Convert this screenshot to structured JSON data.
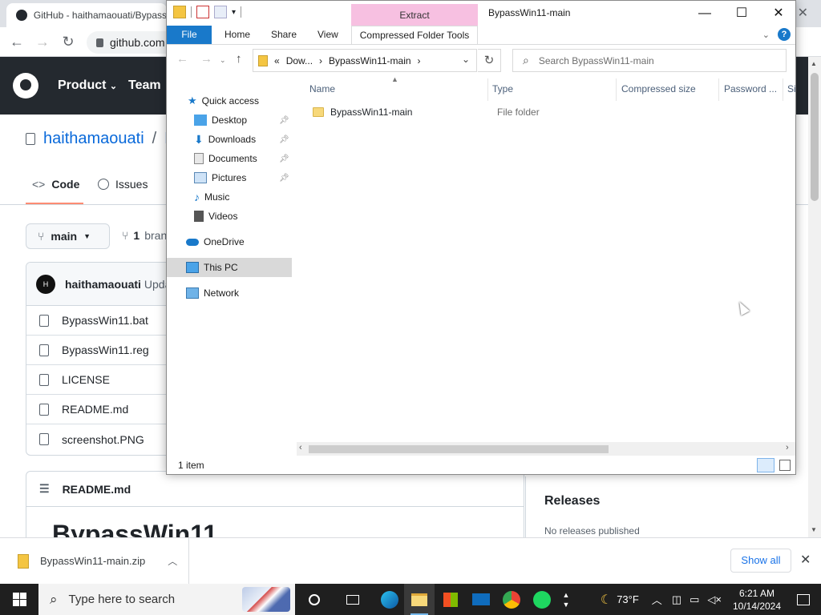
{
  "browser": {
    "tab_title": "GitHub - haithamaouati/Bypass",
    "url": "github.com",
    "nav": {
      "back": "←",
      "forward": "→",
      "reload": "↻"
    }
  },
  "github": {
    "nav_items": [
      "Product",
      "Team"
    ],
    "owner": "haithamaouati",
    "separator": "/",
    "repo_initial": "B",
    "tabs": {
      "code": "Code",
      "issues": "Issues"
    },
    "branch": "main",
    "branches_count": "1",
    "branches_label": "bran",
    "commit": {
      "avatar": "H",
      "author": "haithamaouati",
      "message": "Upda"
    },
    "files": [
      "BypassWin11.bat",
      "BypassWin11.reg",
      "LICENSE",
      "README.md",
      "screenshot.PNG"
    ],
    "readme_file": "README.md",
    "readme_heading": "BypassWin11",
    "releases_title": "Releases",
    "releases_empty": "No releases published"
  },
  "download_bar": {
    "file_name": "BypassWin11-main.zip",
    "show_all": "Show all",
    "close": "✕"
  },
  "explorer": {
    "context_tab": "Extract",
    "title": "BypassWin11-main",
    "ribbon_tabs": {
      "file": "File",
      "home": "Home",
      "share": "Share",
      "view": "View",
      "compressed_tools": "Compressed Folder Tools"
    },
    "address": {
      "chevrons": "«",
      "parent": "Dow...",
      "current": "BypassWin11-main",
      "arrow": "›"
    },
    "search_placeholder": "Search BypassWin11-main",
    "nav_pane": {
      "quick_access": "Quick access",
      "desktop": "Desktop",
      "downloads": "Downloads",
      "documents": "Documents",
      "pictures": "Pictures",
      "music": "Music",
      "videos": "Videos",
      "onedrive": "OneDrive",
      "this_pc": "This PC",
      "network": "Network"
    },
    "columns": {
      "name": "Name",
      "type": "Type",
      "compressed_size": "Compressed size",
      "password": "Password ...",
      "size": "Si"
    },
    "rows": [
      {
        "name": "BypassWin11-main",
        "type": "File folder"
      }
    ],
    "status": "1 item"
  },
  "taskbar": {
    "search_placeholder": "Type here to search",
    "weather": "73°F",
    "time": "6:21 AM",
    "date": "10/14/2024"
  },
  "colors": {
    "github_header": "#24292f",
    "link_blue": "#0969da",
    "explorer_file_tab": "#1979ca",
    "extract_context": "#f7c0e1",
    "taskbar": "#1f1f1f"
  }
}
